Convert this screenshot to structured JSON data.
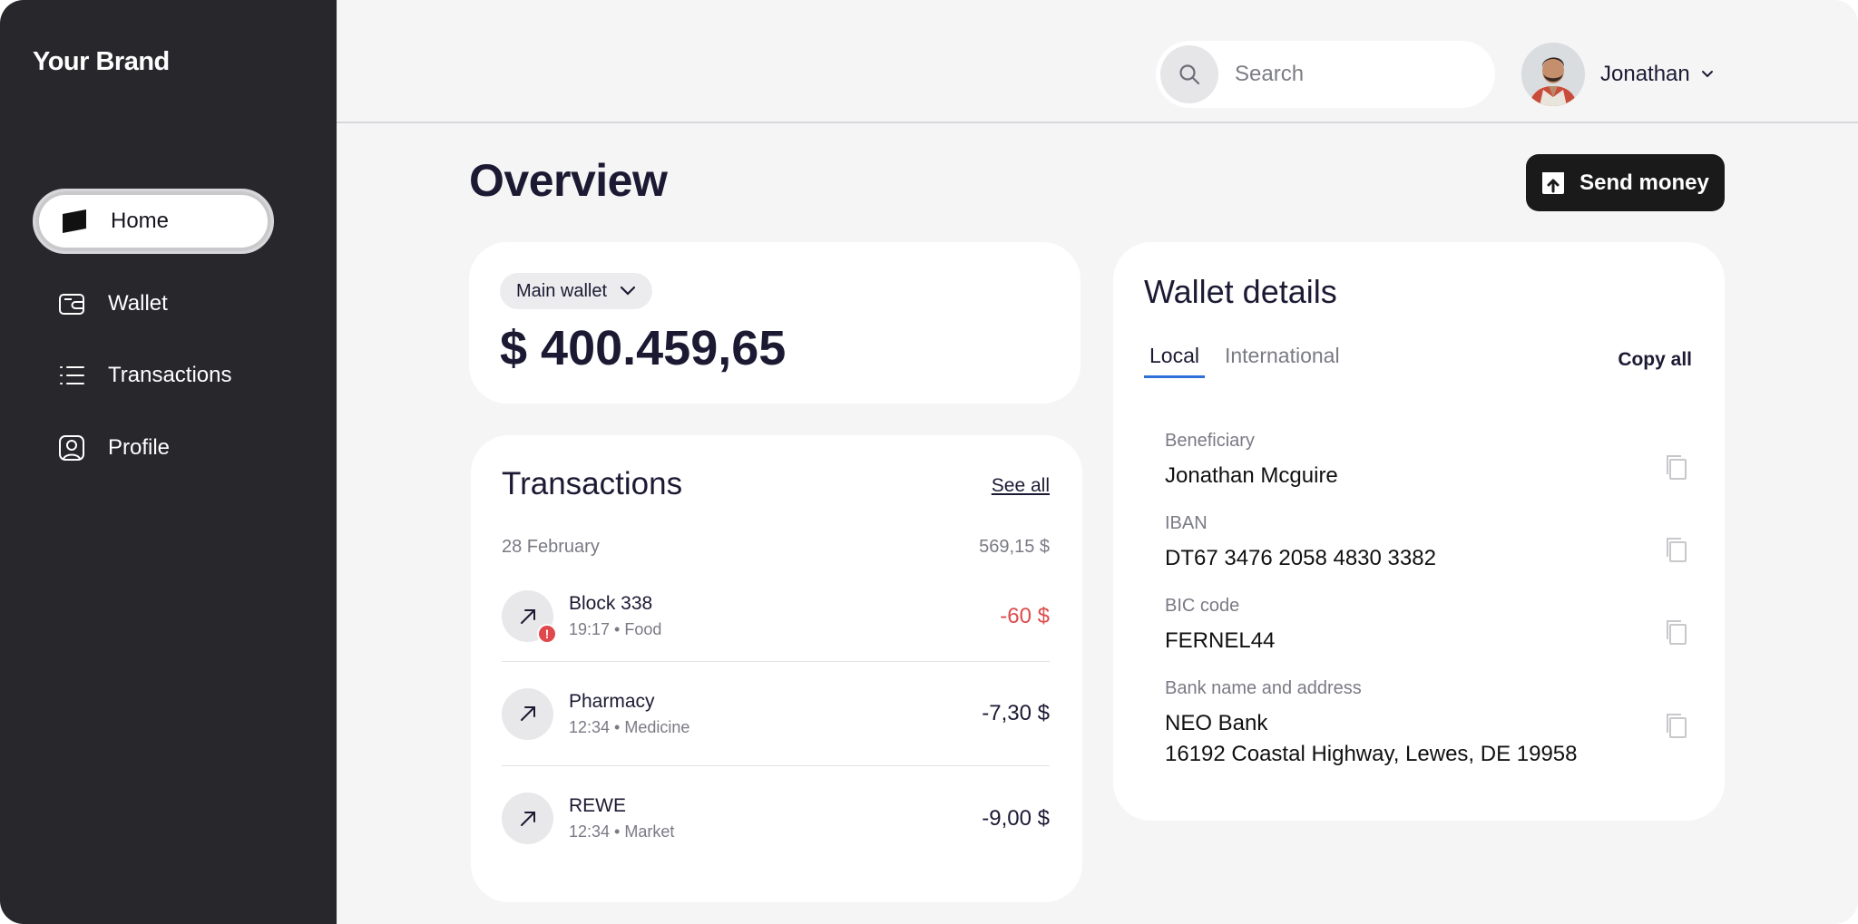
{
  "brand": "Your Brand",
  "sidebar": {
    "items": [
      {
        "label": "Home",
        "icon": "home-icon",
        "active": true
      },
      {
        "label": "Wallet",
        "icon": "wallet-icon",
        "active": false
      },
      {
        "label": "Transactions",
        "icon": "list-icon",
        "active": false
      },
      {
        "label": "Profile",
        "icon": "profile-icon",
        "active": false
      }
    ]
  },
  "header": {
    "search_placeholder": "Search",
    "user_name": "Jonathan"
  },
  "overview": {
    "title": "Overview",
    "send_button": "Send money"
  },
  "balance": {
    "wallet_label": "Main wallet",
    "amount": "$ 400.459,65"
  },
  "transactions": {
    "title": "Transactions",
    "see_all": "See all",
    "date": "28 February",
    "date_total": "569,15 $",
    "rows": [
      {
        "name": "Block 338",
        "meta": "19:17 • Food",
        "amount": "-60 $",
        "alert": true
      },
      {
        "name": "Pharmacy",
        "meta": "12:34 • Medicine",
        "amount": "-7,30 $",
        "alert": false
      },
      {
        "name": "REWE",
        "meta": "12:34 • Market",
        "amount": "-9,00 $",
        "alert": false
      }
    ]
  },
  "wallet_details": {
    "title": "Wallet details",
    "tabs": [
      "Local",
      "International"
    ],
    "active_tab": "Local",
    "copy_all": "Copy all",
    "fields": [
      {
        "label": "Beneficiary",
        "value": "Jonathan Mcguire"
      },
      {
        "label": "IBAN",
        "value": "DT67 3476 2058 4830 3382"
      },
      {
        "label": "BIC code",
        "value": "FERNEL44"
      },
      {
        "label": "Bank name and address",
        "value_line1": "NEO Bank",
        "value_line2": "16192 Coastal Highway, Lewes, DE 19958"
      }
    ]
  },
  "colors": {
    "sidebar_bg": "#27272c",
    "accent_tab": "#2f6fd8",
    "negative": "#df4b4b",
    "button_bg": "#1a1a1a"
  }
}
